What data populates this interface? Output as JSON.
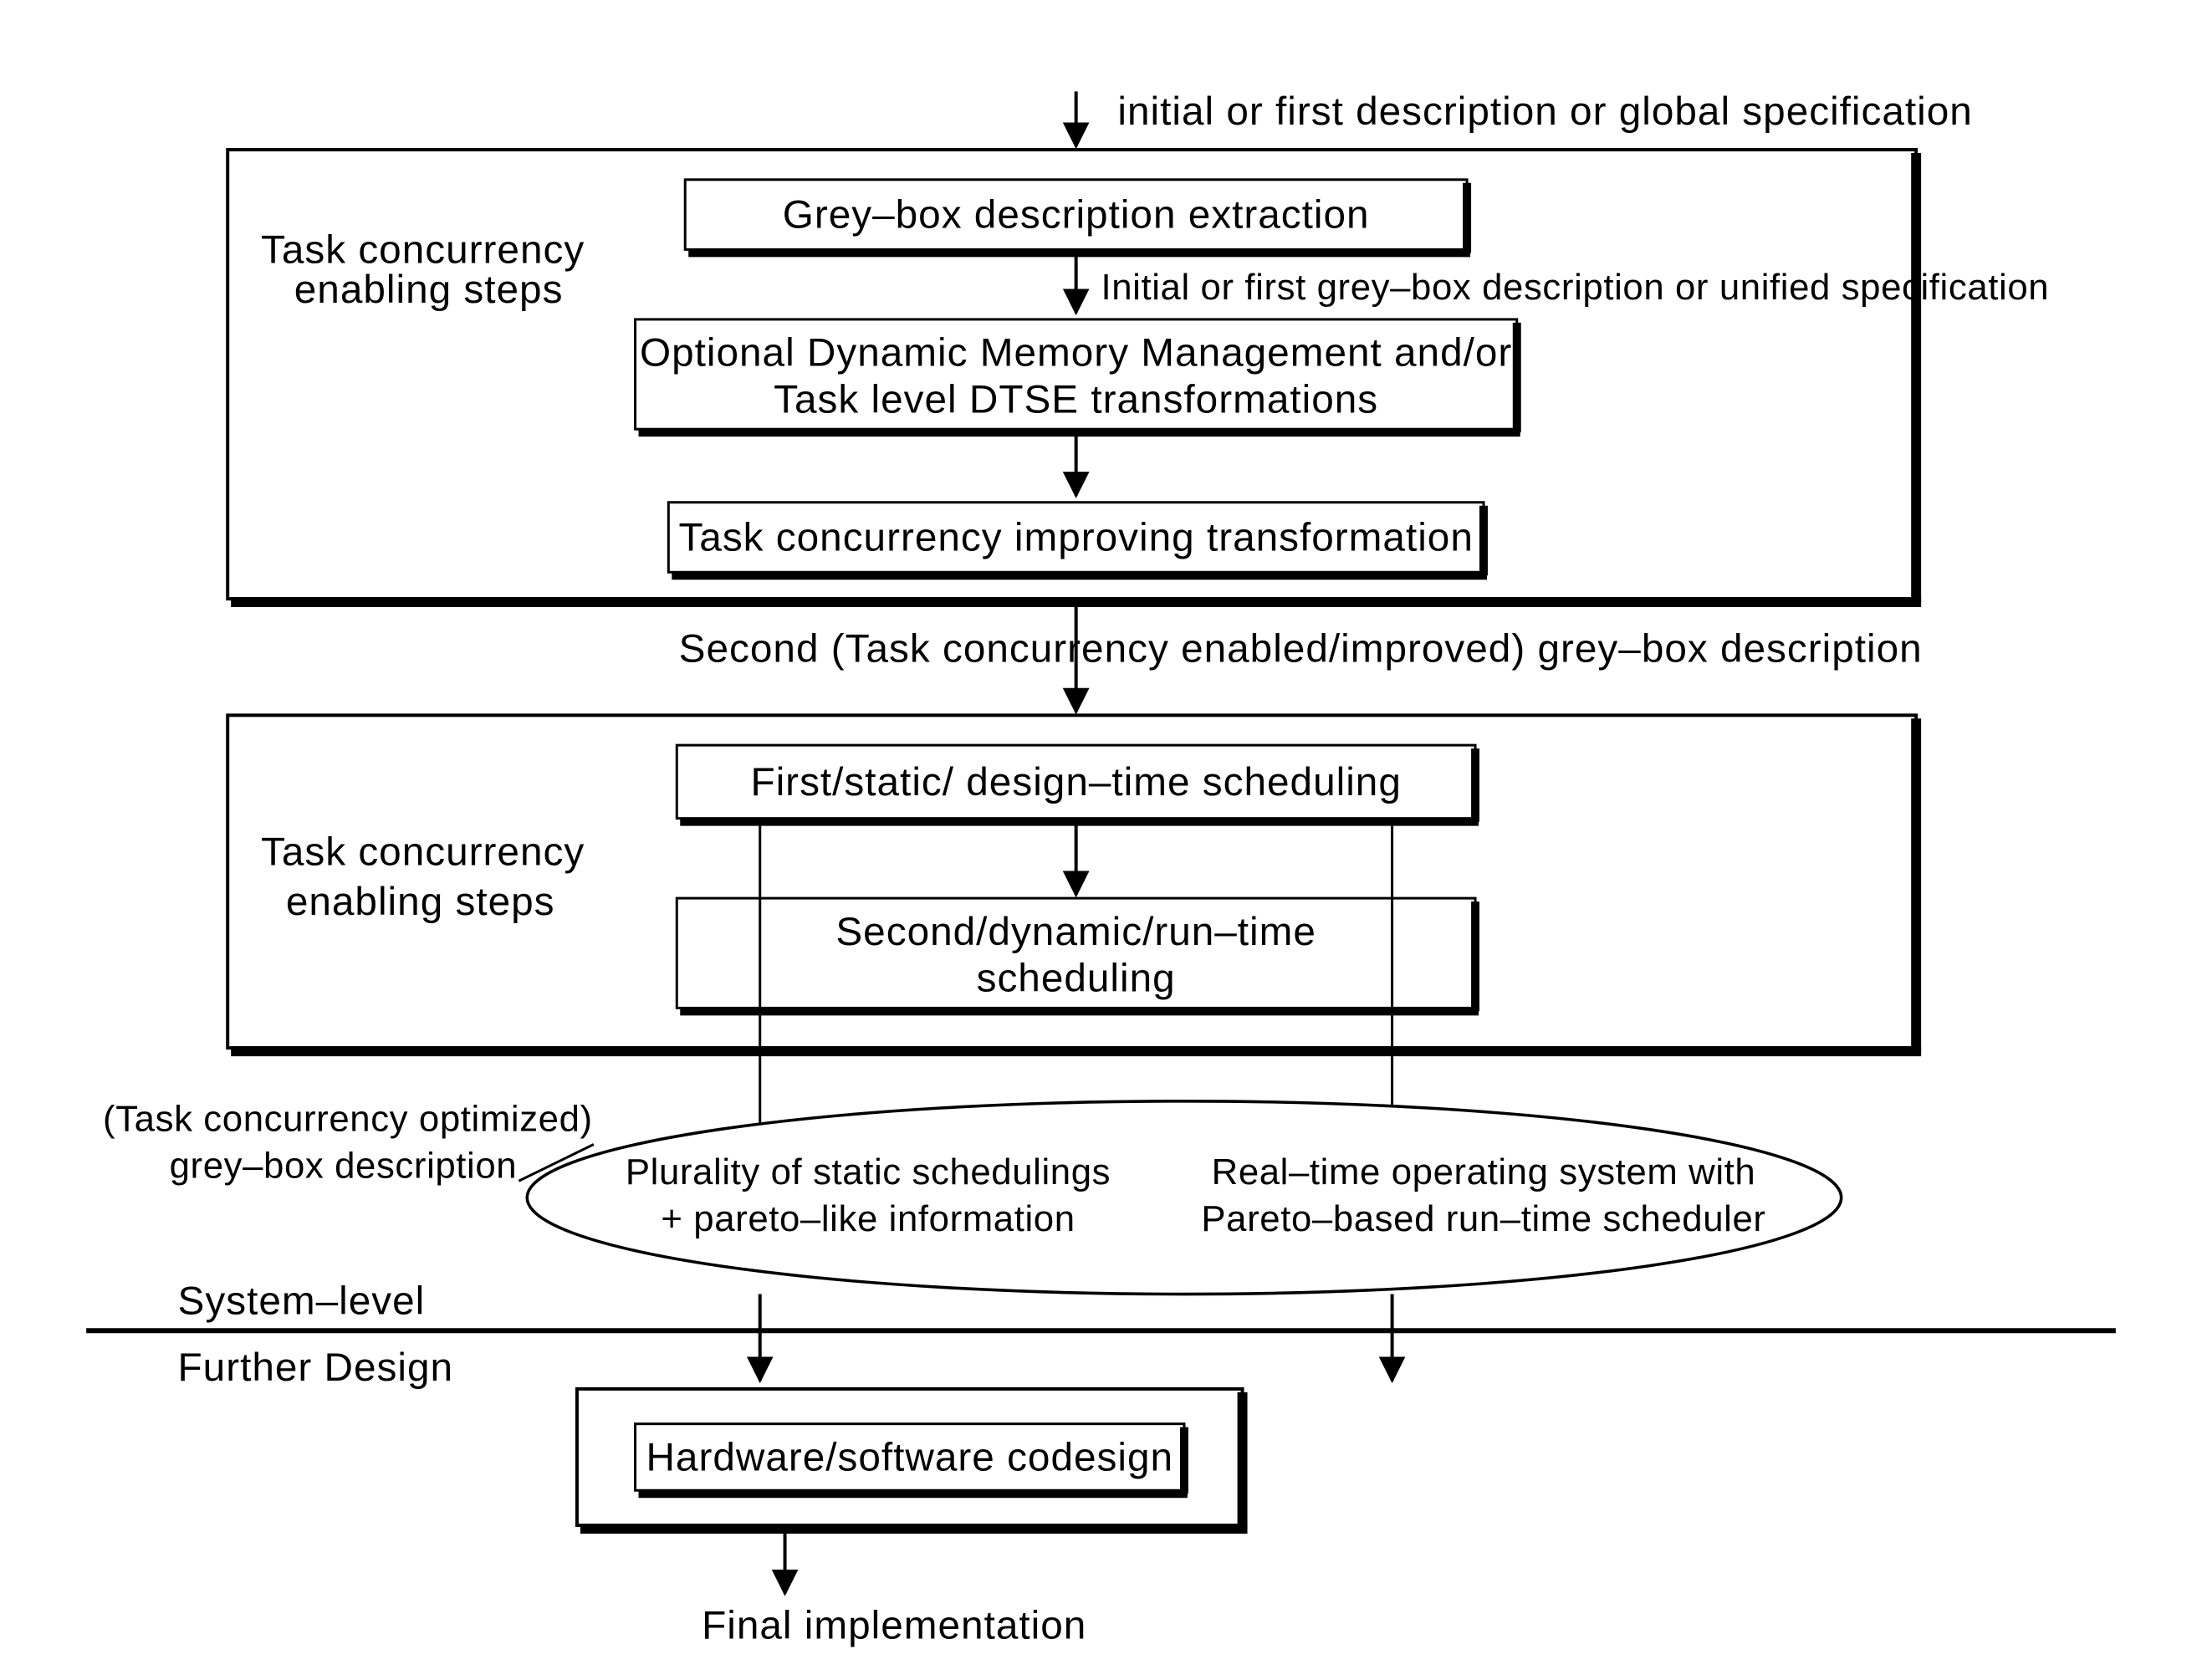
{
  "labels": {
    "top": "initial or first description or global specification",
    "enable1": "Task concurrency",
    "enable1b": "enabling steps",
    "box_grey": "Grey–box description extraction",
    "mid1": "Initial or first grey–box description or unified specification",
    "box_opt1": "Optional Dynamic Memory Management and/or",
    "box_opt2": "Task level DTSE transformations",
    "box_tci": "Task concurrency improving transformation",
    "second_desc": "Second (Task concurrency enabled/improved) grey–box description",
    "enable2a": "Task concurrency",
    "enable2b": "enabling steps",
    "box_first_sched": "First/static/ design–time scheduling",
    "box_second_sched1": "Second/dynamic/run–time",
    "box_second_sched2": "scheduling",
    "tco1": "(Task concurrency optimized)",
    "tco2": "grey–box description",
    "ellipse_left1": "Plurality of static schedulings",
    "ellipse_left2": "+ pareto–like information",
    "ellipse_right1": "Real–time operating system with",
    "ellipse_right2": "Pareto–based run–time scheduler",
    "system_level": "System–level",
    "further": "Further Design",
    "box_hw": "Hardware/software codesign",
    "final": "Final implementation"
  }
}
